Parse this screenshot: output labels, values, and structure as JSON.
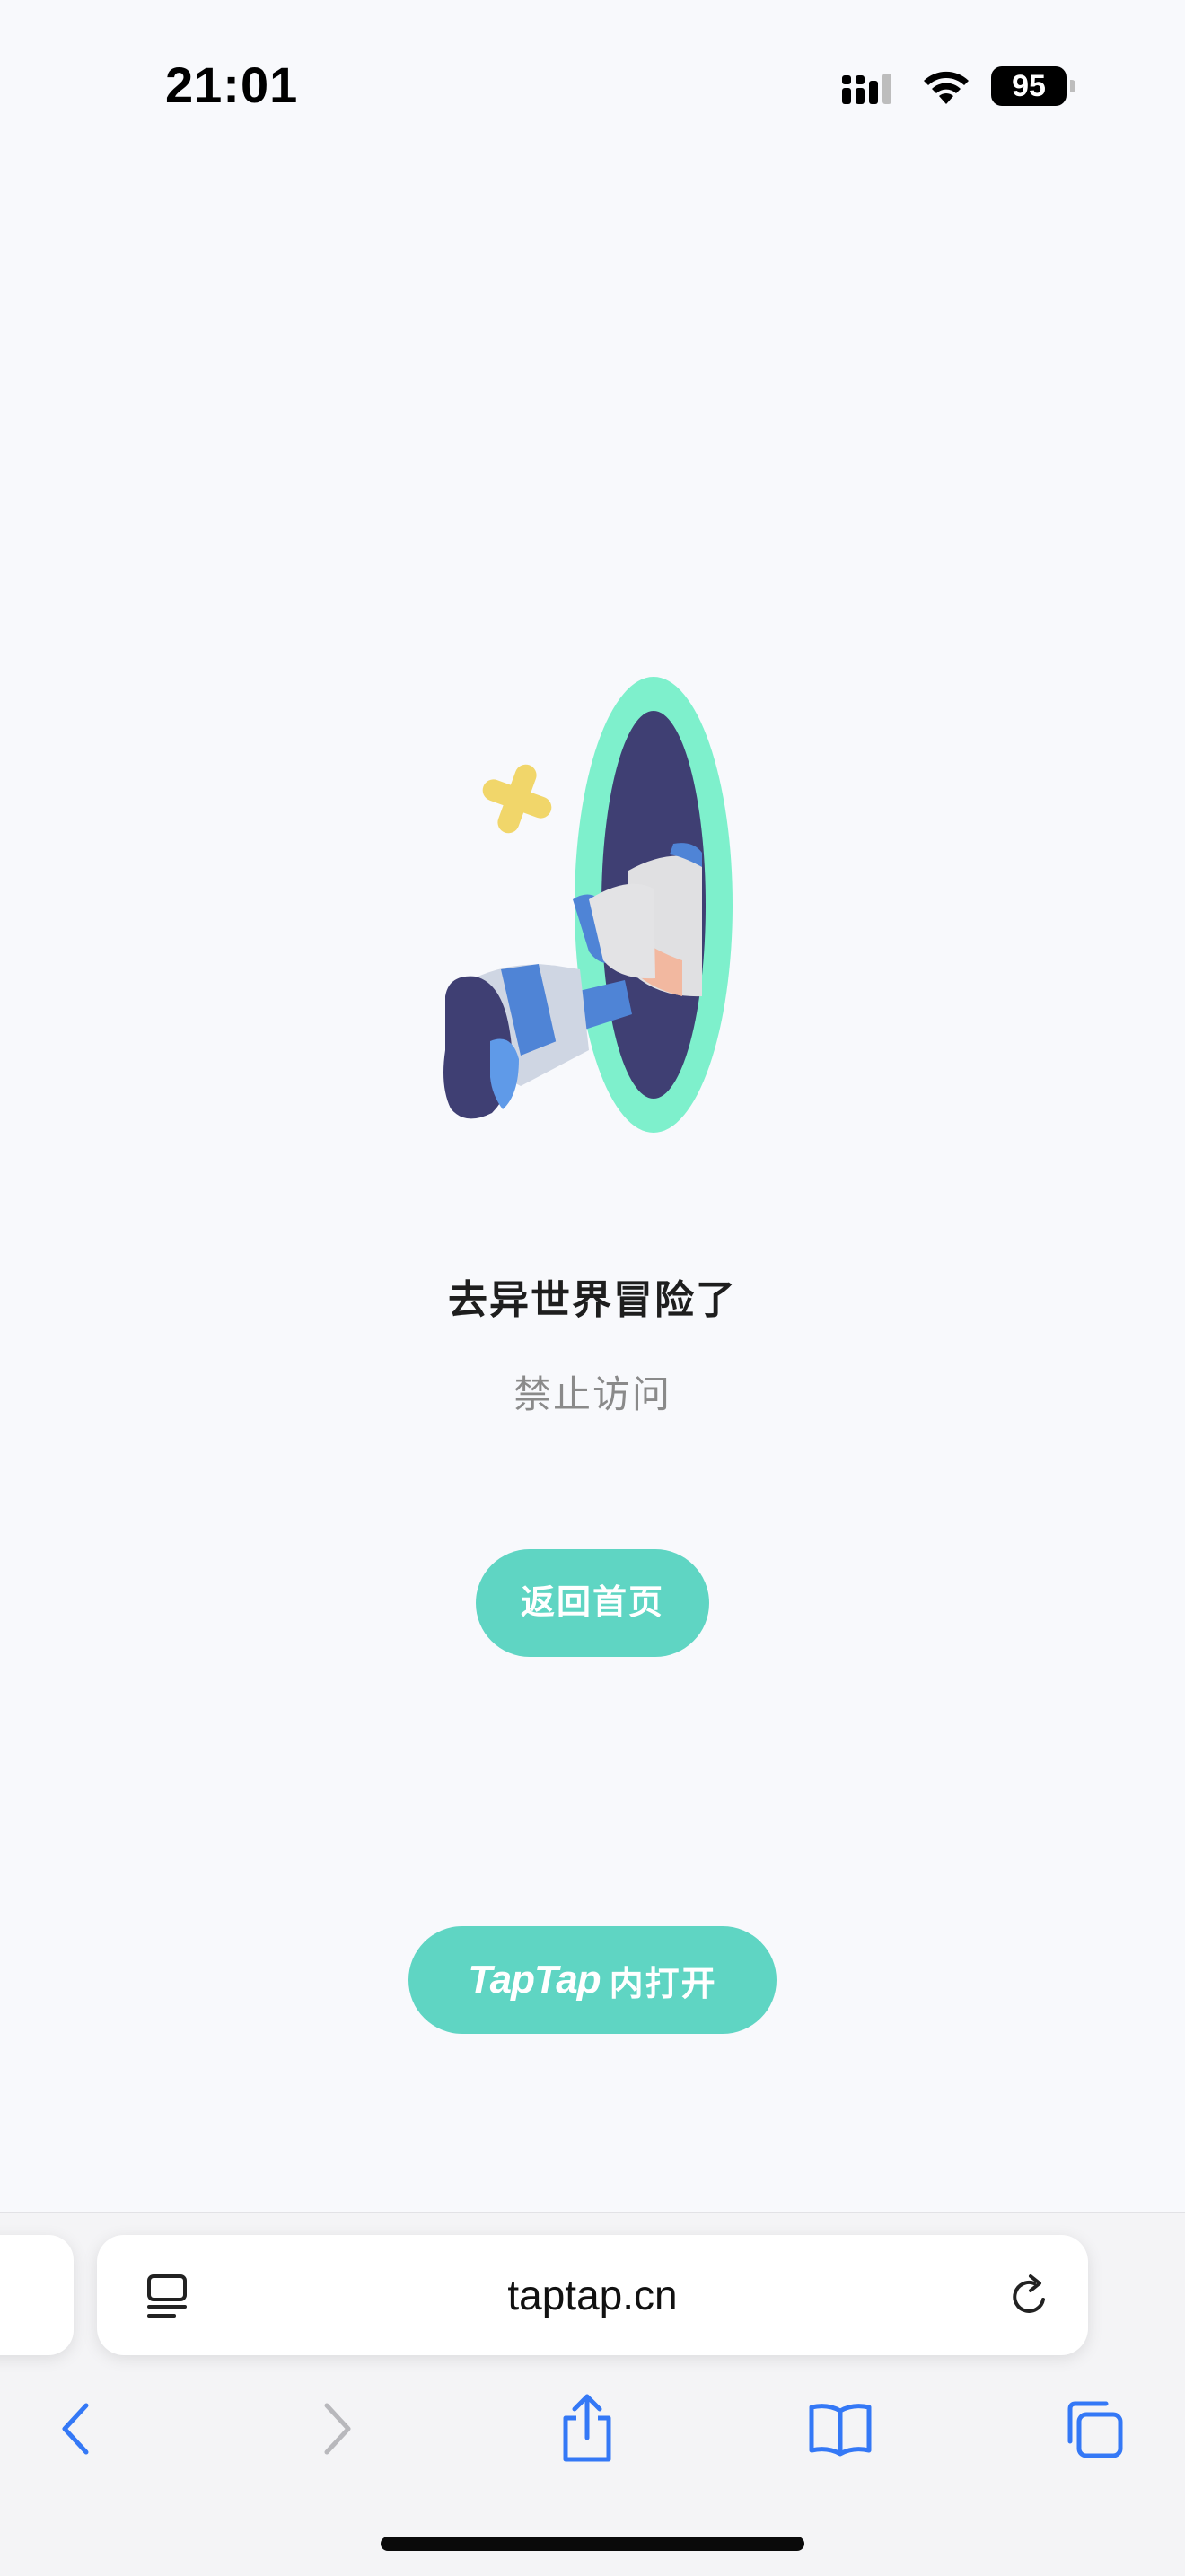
{
  "status_bar": {
    "time": "21:01",
    "battery_level": "95",
    "signal_icon": "cellular-signal-icon",
    "wifi_icon": "wifi-icon"
  },
  "page": {
    "illustration_icon": "portal-leg-illustration",
    "title": "去异世界冒险了",
    "subtitle": "禁止访问",
    "home_button_label": "返回首页",
    "open_app_logo": "TapTap",
    "open_app_label": "内打开"
  },
  "browser": {
    "url": "taptap.cn",
    "reader_icon": "reader-mode-icon",
    "reload_icon": "reload-icon",
    "toolbar": {
      "back_icon": "chevron-left-icon",
      "forward_icon": "chevron-right-icon",
      "share_icon": "share-icon",
      "bookmarks_icon": "book-icon",
      "tabs_icon": "tabs-icon"
    }
  },
  "colors": {
    "background": "#f8f9fc",
    "accent": "#5fd5c3",
    "toolbar_icon": "#3478f6",
    "portal_ring": "#7ef0cc",
    "portal_inner": "#3f3f73"
  }
}
